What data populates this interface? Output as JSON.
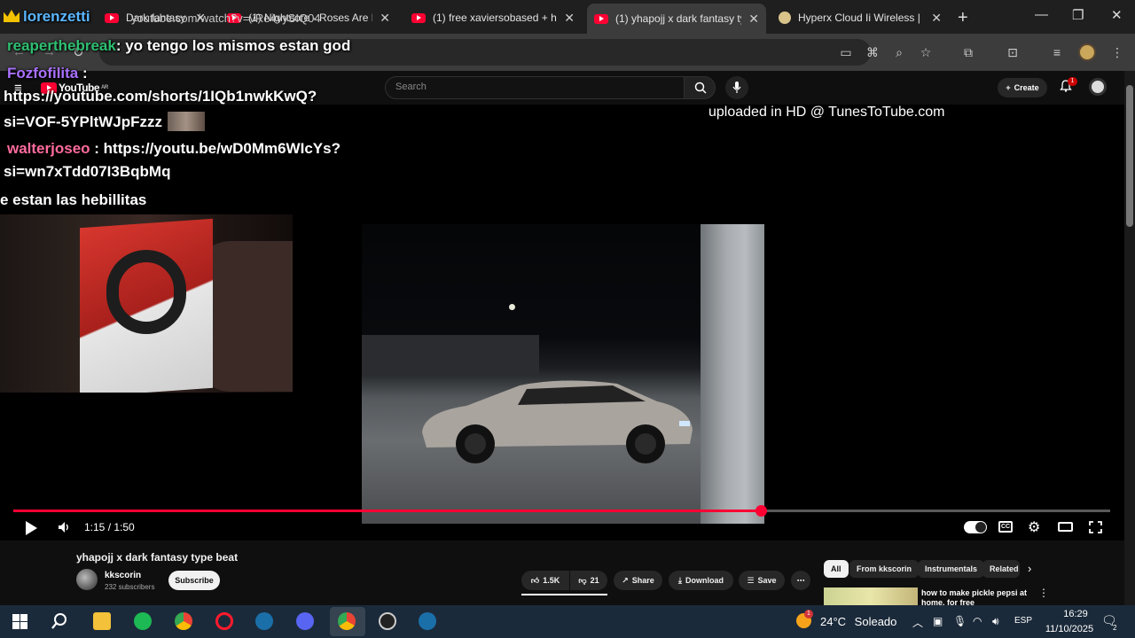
{
  "browser": {
    "tabs": [
      {
        "title": "Dark fantasy music - YouT",
        "icon": "youtube-favicon"
      },
      {
        "title": "(1) Nightcore - Roses Are Re",
        "icon": "youtube-favicon"
      },
      {
        "title": "(1) free xaviersobased + hoo",
        "icon": "youtube-favicon"
      },
      {
        "title": "(1) yhapojj x dark fantasy typ",
        "icon": "youtube-favicon"
      },
      {
        "title": "Hyperx Cloud Ii Wireless | M",
        "icon": "headset-favicon"
      }
    ],
    "url": "youtube.com/watch?v=vRe4vySIQ04"
  },
  "youtube": {
    "logo_text": "YouTube",
    "logo_suffix": "AR",
    "search_placeholder": "Search",
    "create_label": "Create",
    "notification_count": "1"
  },
  "overlay": {
    "watermark": "uploaded in HD @ TunesToTube.com",
    "chat": [
      {
        "user": "lorenzetti",
        "text": ""
      },
      {
        "user": "reaperthebreak",
        "text": ": yo tengo los mismos estan god"
      },
      {
        "user": "Fozfofilita",
        "text": " :"
      },
      {
        "user": "",
        "text": "https://youtube.com/shorts/1IQb1nwkKwQ?"
      },
      {
        "user": "",
        "text": "si=VOF-5YPltWJpFzzz"
      },
      {
        "user": "walterjoseo",
        "text": " : https://youtu.be/wD0Mm6WIcYs?"
      },
      {
        "user": "",
        "text": "si=wn7xTdd07I3BqbMq"
      },
      {
        "user": "",
        "text": "e estan las hebillitas"
      }
    ]
  },
  "player": {
    "current_time": "1:15",
    "duration": "1:50",
    "time_display": "1:15 / 1:50",
    "progress_fraction": 0.6818
  },
  "video_info": {
    "title": "yhapojj x dark fantasy type beat",
    "channel": "kkscorin",
    "subscribers": "232 subscribers",
    "subscribe_label": "Subscribe",
    "likes": "1.5K",
    "dislikes": "21",
    "share_label": "Share",
    "download_label": "Download",
    "save_label": "Save"
  },
  "recommendations": {
    "chips": [
      "All",
      "From kkscorin",
      "Instrumentals",
      "Related"
    ],
    "first_title": "how to make pickle pepsi at home. for free"
  },
  "taskbar": {
    "temperature": "24°C",
    "condition": "Soleado",
    "weather_badge": "1",
    "language": "ESP",
    "time": "16:29",
    "date": "11/10/2025",
    "notification_count": "2"
  }
}
